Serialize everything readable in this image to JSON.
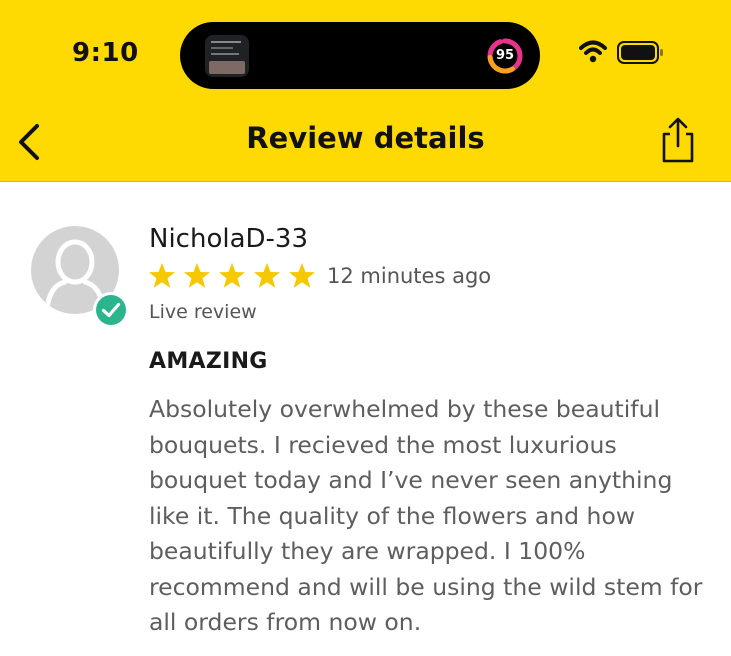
{
  "status_bar": {
    "time": "9:10",
    "activity_ring_value": "95",
    "icons": [
      "wifi-icon",
      "battery-icon"
    ]
  },
  "header": {
    "title": "Review details",
    "back_icon": "chevron-left-icon",
    "share_icon": "share-icon"
  },
  "review": {
    "reviewer_name": "NicholaD-33",
    "rating": 5,
    "max_rating": 5,
    "time_ago": "12 minutes ago",
    "status": "Live review",
    "title": "AMAZING",
    "body": "Absolutely overwhelmed by these beautiful bouquets. I recieved the most luxurious bouquet today and I’ve never seen anything like it. The quality of the flowers and how beautifully they are wrapped. I 100% recommend and will be using the wild stem for all orders from now on."
  },
  "colors": {
    "header_bg": "#ffd902",
    "star": "#f5c800",
    "verified_badge": "#2bb58f"
  }
}
